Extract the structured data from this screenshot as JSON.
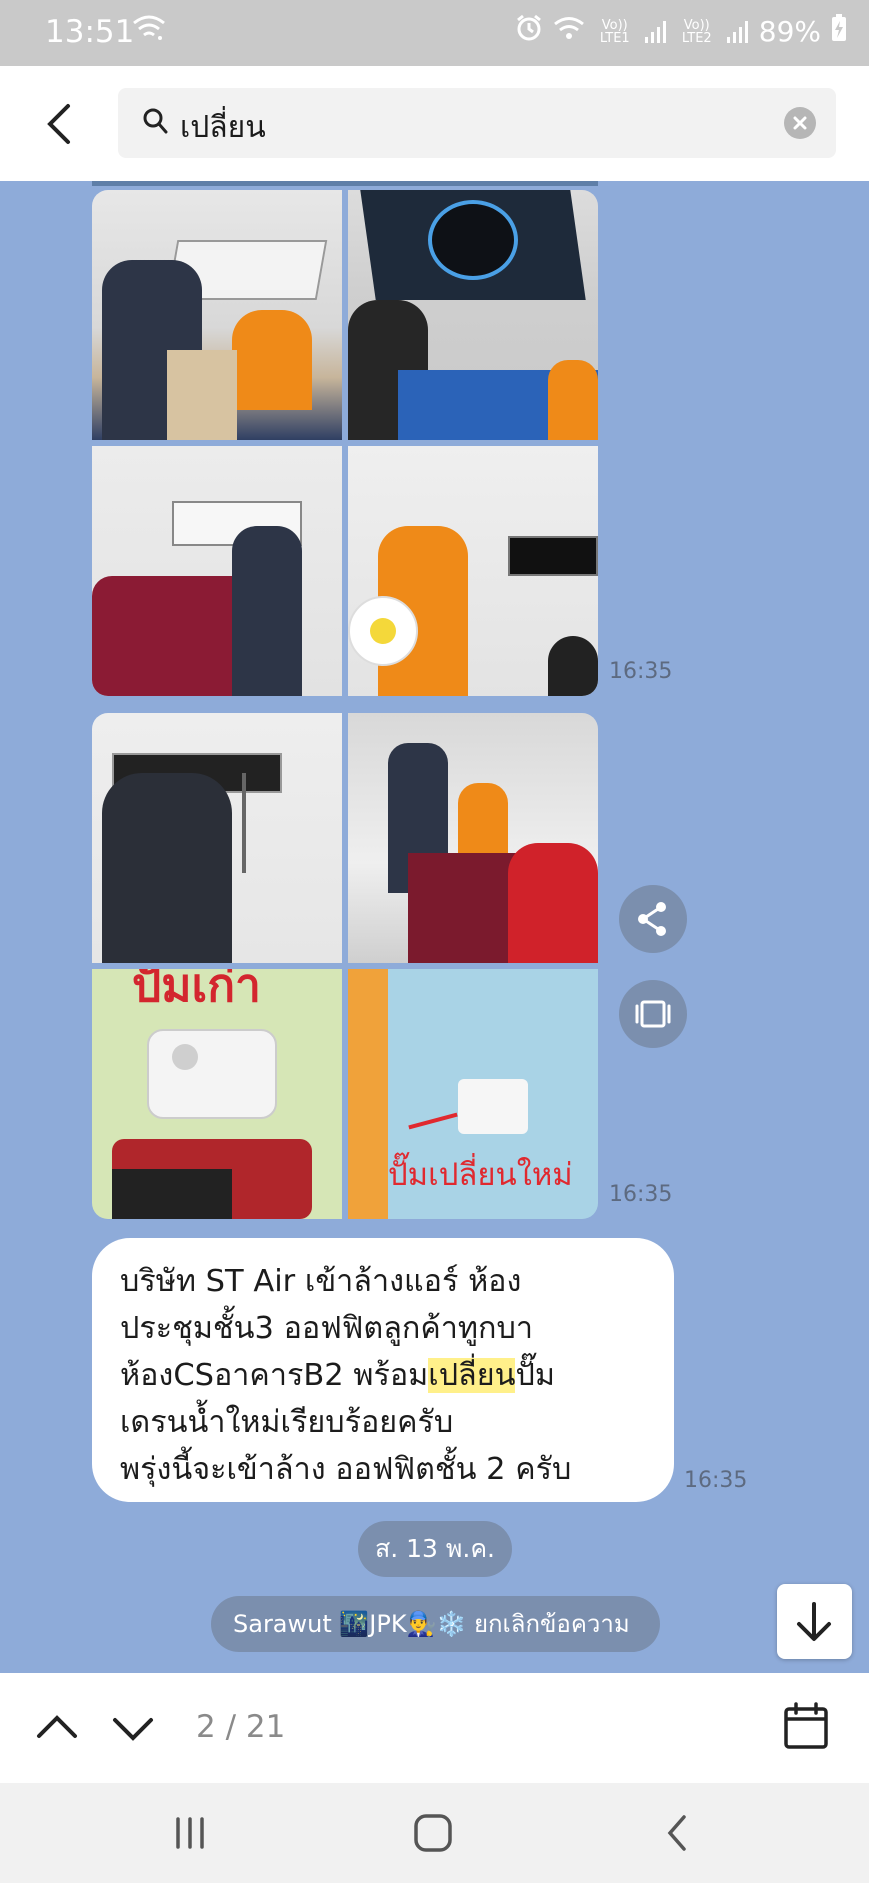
{
  "status_bar": {
    "time": "13:51",
    "sim1": "Vo)) LTE1",
    "sim2": "Vo)) LTE2",
    "battery": "89%"
  },
  "search": {
    "query": "เปลี่ยน"
  },
  "messages": {
    "grid1_time": "16:35",
    "grid2_time": "16:35",
    "photo_caption": "ปั๊มเปลี่ยนใหม่",
    "text_time": "16:35",
    "text_lines": [
      "บริษัท ST Air เข้าล้างแอร์ ห้อง",
      "ประชุมชั้น3  ออฟฟิตลูกค้าทูกบา",
      "ห้องCSอาคารB2 พร้อม",
      "เดรนน้ำใหม่เรียบร้อยครับ",
      "พรุ่งนี้จะเข้าล้าง ออฟฟิตชั้น 2  ครับ"
    ],
    "highlight_word": "เปลี่ยน",
    "line3_tail": "ปั๊ม"
  },
  "date_divider": "ส. 13 พ.ค.",
  "notice": "Sarawut 🌃JPK👨‍🔧❄️ ยกเลิกข้อความ",
  "result_counter": "2 / 21",
  "colors": {
    "chat_background": "#8eabd9",
    "highlight": "#fff08a",
    "pill": "#7b8fae"
  }
}
